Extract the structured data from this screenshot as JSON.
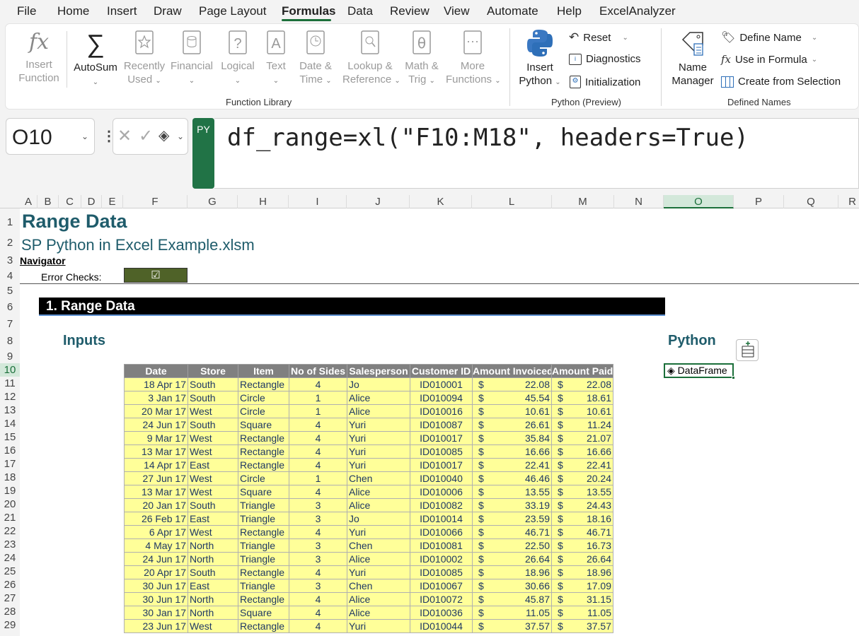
{
  "menu": {
    "items": [
      "File",
      "Home",
      "Insert",
      "Draw",
      "Page Layout",
      "Formulas",
      "Data",
      "Review",
      "View",
      "Automate",
      "Help",
      "ExcelAnalyzer"
    ],
    "active": "Formulas"
  },
  "ribbon": {
    "insert_function": [
      "Insert",
      "Function"
    ],
    "autosum": "AutoSum",
    "recently_used": [
      "Recently",
      "Used"
    ],
    "financial": "Financial",
    "logical": "Logical",
    "text": "Text",
    "date_time": [
      "Date &",
      "Time"
    ],
    "lookup_reference": [
      "Lookup &",
      "Reference"
    ],
    "math_trig": [
      "Math &",
      "Trig"
    ],
    "more_functions": [
      "More",
      "Functions"
    ],
    "group_function_library": "Function Library",
    "insert_python": [
      "Insert",
      "Python"
    ],
    "reset": "Reset",
    "diagnostics": "Diagnostics",
    "initialization": "Initialization",
    "group_python": "Python (Preview)",
    "name_manager": [
      "Name",
      "Manager"
    ],
    "define_name": "Define Name",
    "use_in_formula": "Use in Formula",
    "create_from_selection": "Create from Selection",
    "group_defined_names": "Defined Names"
  },
  "formula_bar": {
    "name_box": "O10",
    "py_badge": "PY",
    "formula": "df_range=xl(\"F10:M18\", headers=True)"
  },
  "grid": {
    "columns": [
      "A",
      "B",
      "C",
      "D",
      "E",
      "F",
      "G",
      "H",
      "I",
      "J",
      "K",
      "L",
      "M",
      "N",
      "O",
      "P",
      "Q",
      "R"
    ],
    "selected_column": "O",
    "rows": [
      1,
      2,
      3,
      4,
      5,
      6,
      7,
      8,
      9,
      10,
      11,
      12,
      13,
      14,
      15,
      16,
      17,
      18,
      19,
      20,
      21,
      22,
      23,
      24,
      25,
      26,
      27,
      28,
      29
    ],
    "selected_row": 10
  },
  "sheet": {
    "title": "Range Data",
    "subtitle": "SP Python in Excel Example.xlsm",
    "navigator": "Navigator",
    "error_checks_label": "Error Checks:",
    "error_checks_value": "☑",
    "section_title": "1. Range Data",
    "inputs_label": "Inputs",
    "python_label": "Python",
    "dataframe_cell": "DataFrame"
  },
  "table": {
    "headers": [
      "Date",
      "Store",
      "Item",
      "No of Sides",
      "Salesperson",
      "Customer ID",
      "Amount Invoiced",
      "Amount Paid"
    ],
    "currency_symbol": "$",
    "rows": [
      [
        "18 Apr 17",
        "South",
        "Rectangle",
        "4",
        "Jo",
        "ID010001",
        "22.08",
        "22.08"
      ],
      [
        "3 Jan 17",
        "South",
        "Circle",
        "1",
        "Alice",
        "ID010094",
        "45.54",
        "18.61"
      ],
      [
        "20 Mar 17",
        "West",
        "Circle",
        "1",
        "Alice",
        "ID010016",
        "10.61",
        "10.61"
      ],
      [
        "24 Jun 17",
        "South",
        "Square",
        "4",
        "Yuri",
        "ID010087",
        "26.61",
        "11.24"
      ],
      [
        "9 Mar 17",
        "West",
        "Rectangle",
        "4",
        "Yuri",
        "ID010017",
        "35.84",
        "21.07"
      ],
      [
        "13 Mar 17",
        "West",
        "Rectangle",
        "4",
        "Yuri",
        "ID010085",
        "16.66",
        "16.66"
      ],
      [
        "14 Apr 17",
        "East",
        "Rectangle",
        "4",
        "Yuri",
        "ID010017",
        "22.41",
        "22.41"
      ],
      [
        "27 Jun 17",
        "West",
        "Circle",
        "1",
        "Chen",
        "ID010040",
        "46.46",
        "20.24"
      ],
      [
        "13 Mar 17",
        "West",
        "Square",
        "4",
        "Alice",
        "ID010006",
        "13.55",
        "13.55"
      ],
      [
        "20 Jan 17",
        "South",
        "Triangle",
        "3",
        "Alice",
        "ID010082",
        "33.19",
        "24.43"
      ],
      [
        "26 Feb 17",
        "East",
        "Triangle",
        "3",
        "Jo",
        "ID010014",
        "23.59",
        "18.16"
      ],
      [
        "6 Apr 17",
        "West",
        "Rectangle",
        "4",
        "Yuri",
        "ID010066",
        "46.71",
        "46.71"
      ],
      [
        "4 May 17",
        "North",
        "Triangle",
        "3",
        "Chen",
        "ID010081",
        "22.50",
        "16.73"
      ],
      [
        "24 Jun 17",
        "North",
        "Triangle",
        "3",
        "Alice",
        "ID010002",
        "26.64",
        "26.64"
      ],
      [
        "20 Apr 17",
        "South",
        "Rectangle",
        "4",
        "Yuri",
        "ID010085",
        "18.96",
        "18.96"
      ],
      [
        "30 Jun 17",
        "East",
        "Triangle",
        "3",
        "Chen",
        "ID010067",
        "30.66",
        "17.09"
      ],
      [
        "30 Jun 17",
        "North",
        "Rectangle",
        "4",
        "Alice",
        "ID010072",
        "45.87",
        "31.15"
      ],
      [
        "30 Jan 17",
        "North",
        "Square",
        "4",
        "Alice",
        "ID010036",
        "11.05",
        "11.05"
      ],
      [
        "23 Jun 17",
        "West",
        "Rectangle",
        "4",
        "Yuri",
        "ID010044",
        "37.57",
        "37.57"
      ]
    ]
  },
  "colors": {
    "accent_green": "#1b6f3a",
    "title_teal": "#1f5c6b",
    "table_fill": "#ffff99",
    "table_header": "#808080",
    "error_box": "#4f6228"
  }
}
